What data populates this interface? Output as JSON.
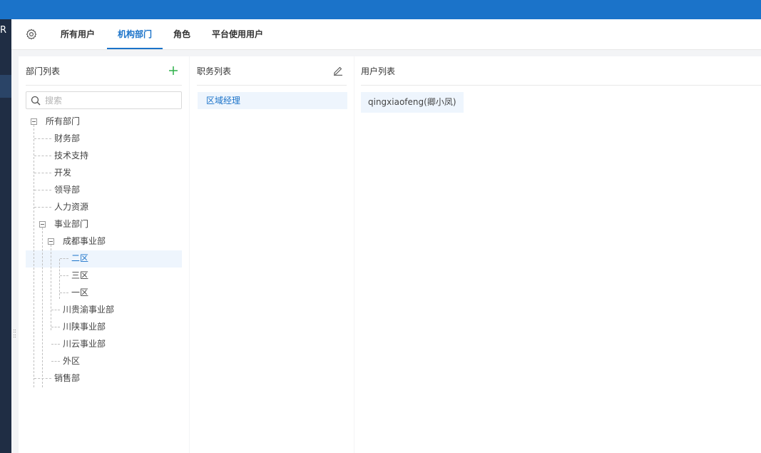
{
  "leftnav": {
    "glyph": "R"
  },
  "tabs": [
    {
      "label": "所有用户",
      "active": false
    },
    {
      "label": "机构部门",
      "active": true
    },
    {
      "label": "角色",
      "active": false
    },
    {
      "label": "平台使用用户",
      "active": false
    }
  ],
  "dept_panel": {
    "title": "部门列表",
    "search_placeholder": "搜索",
    "tree": [
      {
        "label": "所有部门",
        "level": 0,
        "expanded": true
      },
      {
        "label": "财务部",
        "level": 1
      },
      {
        "label": "技术支持",
        "level": 1
      },
      {
        "label": "开发",
        "level": 1
      },
      {
        "label": "领导部",
        "level": 1
      },
      {
        "label": "人力资源",
        "level": 1
      },
      {
        "label": "事业部门",
        "level": 1,
        "expanded": true
      },
      {
        "label": "成都事业部",
        "level": 2,
        "expanded": true
      },
      {
        "label": "二区",
        "level": 3,
        "selected": true
      },
      {
        "label": "三区",
        "level": 3
      },
      {
        "label": "一区",
        "level": 3
      },
      {
        "label": "川贵渝事业部",
        "level": 2
      },
      {
        "label": "川陕事业部",
        "level": 2
      },
      {
        "label": "川云事业部",
        "level": 2
      },
      {
        "label": "外区",
        "level": 2
      },
      {
        "label": "销售部",
        "level": 1
      }
    ]
  },
  "position_panel": {
    "title": "职务列表",
    "items": [
      "区域经理"
    ]
  },
  "user_panel": {
    "title": "用户列表",
    "users": [
      "qingxiaofeng(卿小凤)"
    ]
  },
  "colors": {
    "brand": "#1b73c9",
    "add": "#2fb14a",
    "sidebar": "#1f2d44"
  }
}
